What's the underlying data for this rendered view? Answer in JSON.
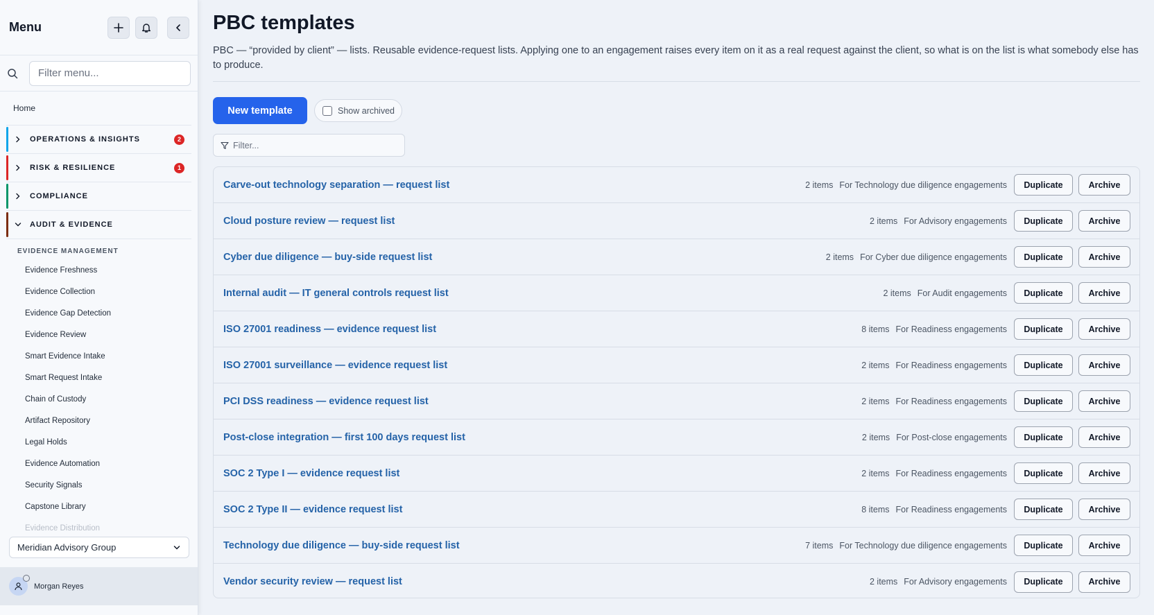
{
  "sidebar": {
    "title": "Menu",
    "search_placeholder": "Filter menu...",
    "home": "Home",
    "groups": [
      {
        "label": "OPERATIONS & INSIGHTS",
        "badge": "2",
        "color": "#0ea5e9"
      },
      {
        "label": "RISK & RESILIENCE",
        "badge": "1",
        "color": "#dc2626"
      },
      {
        "label": "COMPLIANCE",
        "badge": "",
        "color": "#059669"
      },
      {
        "label": "AUDIT & EVIDENCE",
        "badge": "",
        "color": "#7c2d12"
      }
    ],
    "subheading": "EVIDENCE MANAGEMENT",
    "items": [
      "Evidence Freshness",
      "Evidence Collection",
      "Evidence Gap Detection",
      "Evidence Review",
      "Smart Evidence Intake",
      "Smart Request Intake",
      "Chain of Custody",
      "Artifact Repository",
      "Legal Holds",
      "Evidence Automation",
      "Security Signals",
      "Capstone Library",
      "Evidence Distribution"
    ],
    "org": "Meridian Advisory Group",
    "user": "Morgan Reyes"
  },
  "main": {
    "title": "PBC templates",
    "description": "PBC — “provided by client” — lists. Reusable evidence-request lists. Applying one to an engagement raises every item on it as a real request against the client, so what is on the list is what somebody else has to produce.",
    "new_button": "New template",
    "show_archived": "Show archived",
    "filter_placeholder": "Filter...",
    "duplicate_label": "Duplicate",
    "archive_label": "Archive",
    "templates": [
      {
        "name": "Carve-out technology separation — request list",
        "count": "2 items",
        "for": "For Technology due diligence engagements"
      },
      {
        "name": "Cloud posture review — request list",
        "count": "2 items",
        "for": "For Advisory engagements"
      },
      {
        "name": "Cyber due diligence — buy-side request list",
        "count": "2 items",
        "for": "For Cyber due diligence engagements"
      },
      {
        "name": "Internal audit — IT general controls request list",
        "count": "2 items",
        "for": "For Audit engagements"
      },
      {
        "name": "ISO 27001 readiness — evidence request list",
        "count": "8 items",
        "for": "For Readiness engagements"
      },
      {
        "name": "ISO 27001 surveillance — evidence request list",
        "count": "2 items",
        "for": "For Readiness engagements"
      },
      {
        "name": "PCI DSS readiness — evidence request list",
        "count": "2 items",
        "for": "For Readiness engagements"
      },
      {
        "name": "Post-close integration — first 100 days request list",
        "count": "2 items",
        "for": "For Post-close engagements"
      },
      {
        "name": "SOC 2 Type I — evidence request list",
        "count": "2 items",
        "for": "For Readiness engagements"
      },
      {
        "name": "SOC 2 Type II — evidence request list",
        "count": "8 items",
        "for": "For Readiness engagements"
      },
      {
        "name": "Technology due diligence — buy-side request list",
        "count": "7 items",
        "for": "For Technology due diligence engagements"
      },
      {
        "name": "Vendor security review — request list",
        "count": "2 items",
        "for": "For Advisory engagements"
      }
    ]
  },
  "icons": {
    "add": "plus-icon",
    "notifications": "bell-icon",
    "collapse": "chevron-left-icon",
    "search": "search-icon",
    "filter": "funnel-icon",
    "user": "user-icon"
  }
}
